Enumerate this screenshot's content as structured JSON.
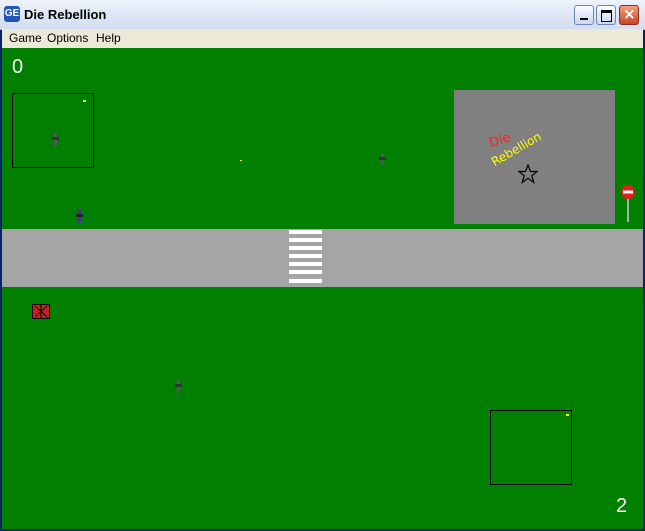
{
  "window": {
    "title": "Die Rebellion",
    "icon_name": "app-icon",
    "icon_text": "GE",
    "controls": [
      "minimize-icon",
      "maximize-icon",
      "close-icon"
    ]
  },
  "menu": {
    "game": "Game",
    "options": "Options",
    "help": "Help"
  },
  "game": {
    "score_left": "0",
    "score_right": "2",
    "hq_label_line1": "Die",
    "hq_label_line2": "Rebellion",
    "colors": {
      "grass": "#007f00",
      "road": "#a5a5a5",
      "hq": "#808080",
      "label_red": "#ff2020",
      "label_yellow": "#ffff00",
      "bomb": "#cc1f1f"
    },
    "objects": [
      "player-base-top",
      "player-base-bottom",
      "guard",
      "hq-building",
      "stop-sign-icon",
      "bomb-crate",
      "star-icon",
      "crosswalk"
    ]
  }
}
